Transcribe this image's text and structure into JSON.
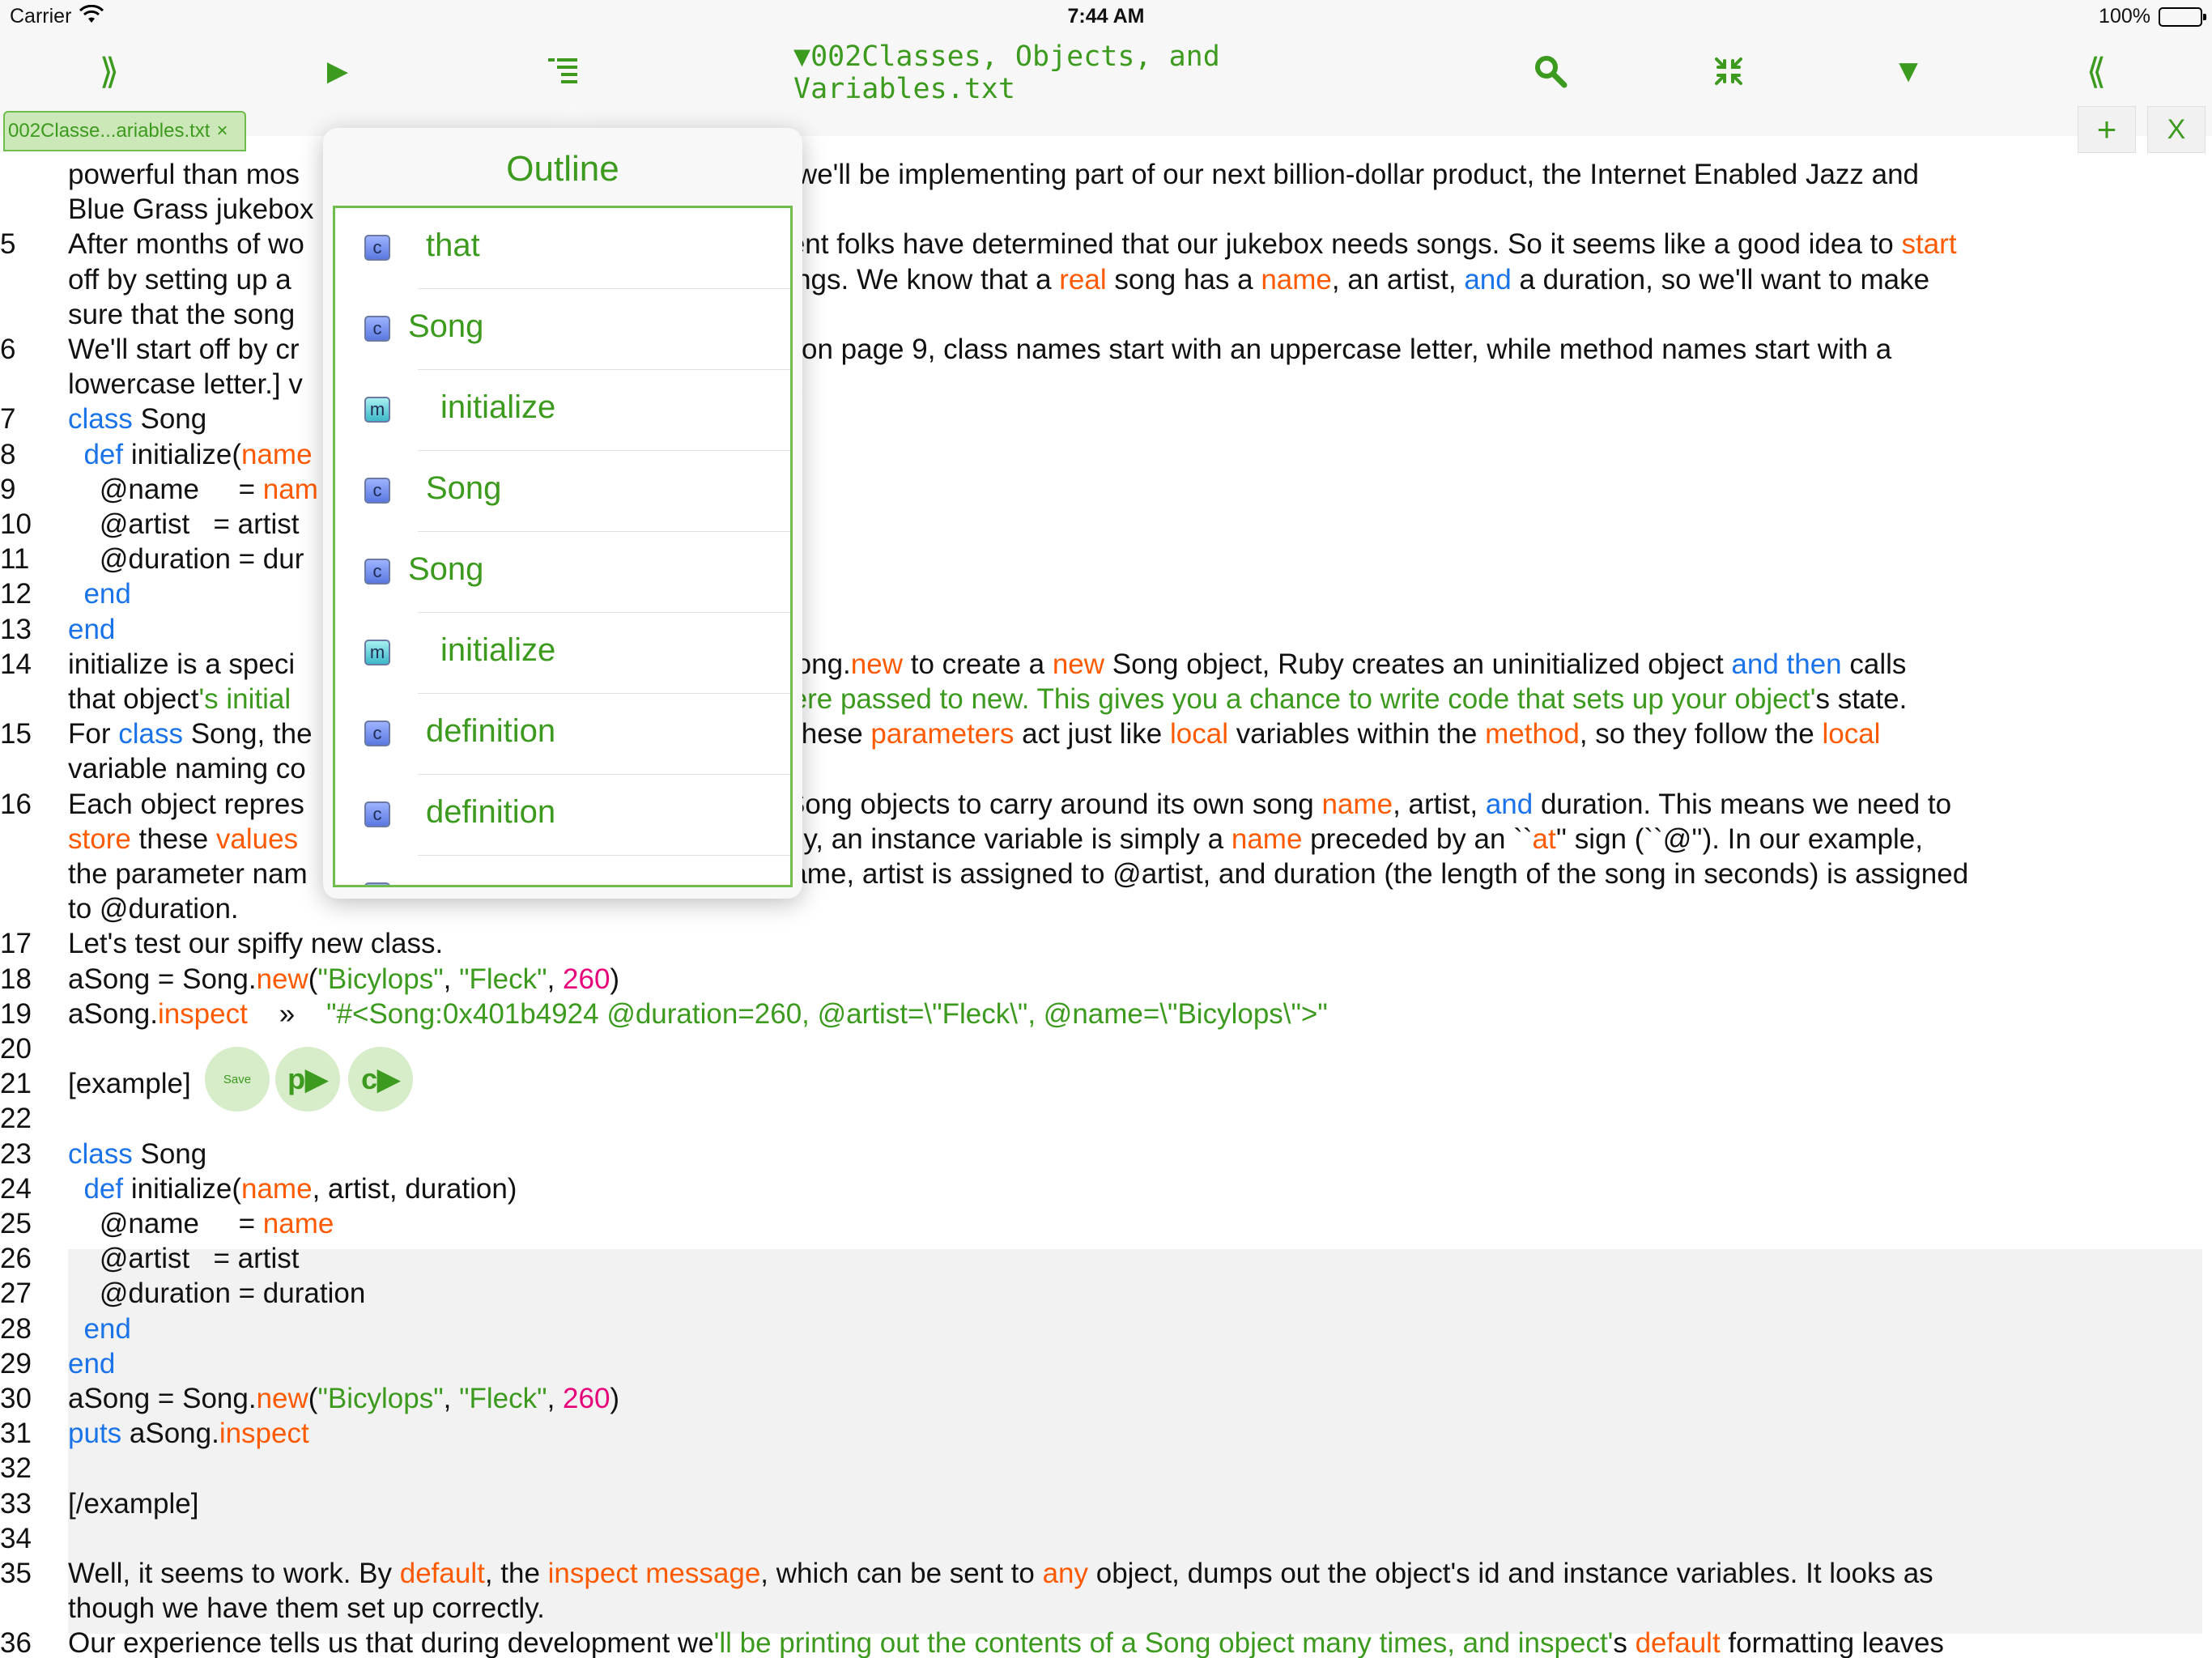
{
  "status_bar": {
    "carrier": "Carrier",
    "time": "7:44 AM",
    "battery": "100%"
  },
  "toolbar": {
    "expand_right": "⟫",
    "run": "▶",
    "outline_icon": "outline-icon",
    "title": "▼002Classes, Objects, and Variables.txt",
    "search_icon": "search-icon",
    "collapse_icon": "collapse-icon",
    "dropdown": "▼",
    "expand_left": "⟪"
  },
  "tab": {
    "label": "002Classe...ariables.txt",
    "close": "×",
    "add": "+",
    "close_all": "X"
  },
  "popover": {
    "title": "Outline",
    "items": [
      {
        "kind": "c",
        "label": "that"
      },
      {
        "kind": "c",
        "label": "Song"
      },
      {
        "kind": "m",
        "label": "initialize"
      },
      {
        "kind": "c",
        "label": "Song"
      },
      {
        "kind": "c",
        "label": "Song"
      },
      {
        "kind": "m",
        "label": "initialize"
      },
      {
        "kind": "c",
        "label": "definition"
      },
      {
        "kind": "c",
        "label": "definition"
      }
    ]
  },
  "example_buttons": {
    "save": "Save",
    "p": "p▶",
    "c": "c▶"
  },
  "editor": {
    "lines": [
      {
        "n": "",
        "t": "powerful than mos                                                 the way, we'll be implementing part of our next billion-dollar product, the Internet Enabled Jazz and"
      },
      {
        "n": "",
        "t": "Blue Grass jukebox"
      },
      {
        "n": "5",
        "html": "After months of wo                                                evelopment folks have determined that our jukebox needs songs. So it seems like a good idea to <span class='o'>start</span>"
      },
      {
        "n": "",
        "html": "off by setting up a                                                hat are songs. We know that a <span class='o'>real</span> song has a <span class='o'>name</span>, an artist, <span class='k'>and</span> a duration, so we'll want to make"
      },
      {
        "n": "",
        "t": "sure that the song"
      },
      {
        "n": "6",
        "t": "We'll start off by cr                                               nentioned on page 9, class names start with an uppercase letter, while method names start with a"
      },
      {
        "n": "",
        "t": "lowercase letter.] v                                                , initialize."
      },
      {
        "n": "7",
        "html": "<span class='k'>class</span> Song"
      },
      {
        "n": "8",
        "html": "  <span class='k'>def</span> initialize(<span class='o'>name</span>"
      },
      {
        "n": "9",
        "html": "    @name     = <span class='o'>nam</span>"
      },
      {
        "n": "10",
        "t": "    @artist   = artist"
      },
      {
        "n": "11",
        "t": "    @duration = dur"
      },
      {
        "n": "12",
        "html": "  <span class='k'>end</span>"
      },
      {
        "n": "13",
        "html": "<span class='k'>end</span>"
      },
      {
        "n": "14",
        "html": "initialize is a speci                                                you <span class='o'>call</span> Song.<span class='o'>new</span> to create a <span class='o'>new</span> Song object, Ruby creates an uninitialized object <span class='k'>and then</span> calls"
      },
      {
        "n": "",
        "html": "that object<span class='g'>'s initial                                               ters that were passed to new. This gives you a chance to write code that sets up your object'</span>s state."
      },
      {
        "n": "15",
        "html": "For <span class='k'>class</span> Song, the                                               <span class='o'>meters</span>. These <span class='o'>parameters</span> act just like <span class='o'>local</span> variables within the <span class='o'>method</span>, so they follow the <span class='o'>local</span>"
      },
      {
        "n": "",
        "t": "variable naming co                                                se letter."
      },
      {
        "n": "16",
        "html": "Each object repres                                                <span class='o'>n</span> of our Song objects to carry around its own song <span class='o'>name</span>, artist, <span class='k'>and</span> duration. This means we need to"
      },
      {
        "n": "",
        "html": "<span class='o'>store</span> these <span class='o'>values</span>                                              ject. In Ruby, an instance variable is simply a <span class='o'>name</span> preceded by an ``<span class='o'>at</span>'' sign (``@''). In our example,"
      },
      {
        "n": "",
        "t": "the parameter nam                                                  ble @name, artist is assigned to @artist, and duration (the length of the song in seconds) is assigned"
      },
      {
        "n": "",
        "t": "to @duration."
      },
      {
        "n": "17",
        "t": "Let's test our spiffy new class."
      },
      {
        "n": "18",
        "html": "aSong = Song.<span class='o'>new</span>(<span class='g'>\"Bicylops\"</span>, <span class='g'>\"Fleck\"</span>, <span class='p'>260</span>)"
      },
      {
        "n": "19",
        "html": "aSong.<span class='o'>inspect</span>    »    <span class='g'>\"#&lt;Song:0x401b4924 @duration=260, @artist=\\\"Fleck\\\", @name=\\\"Bicylops\\\"&gt;\"</span>"
      },
      {
        "n": "20",
        "t": ""
      },
      {
        "n": "21",
        "t": "[example]"
      },
      {
        "n": "22",
        "t": ""
      },
      {
        "n": "23",
        "html": "<span class='k'>class</span> Song"
      },
      {
        "n": "24",
        "html": "  <span class='k'>def</span> initialize(<span class='o'>name</span>, artist, duration)"
      },
      {
        "n": "25",
        "html": "    @name     = <span class='o'>name</span>"
      },
      {
        "n": "26",
        "t": "    @artist   = artist"
      },
      {
        "n": "27",
        "t": "    @duration = duration"
      },
      {
        "n": "28",
        "html": "  <span class='k'>end</span>"
      },
      {
        "n": "29",
        "html": "<span class='k'>end</span>"
      },
      {
        "n": "30",
        "html": "aSong = Song.<span class='o'>new</span>(<span class='g'>\"Bicylops\"</span>, <span class='g'>\"Fleck\"</span>, <span class='p'>260</span>)"
      },
      {
        "n": "31",
        "html": "<span class='k'>puts</span> aSong.<span class='o'>inspect</span>"
      },
      {
        "n": "32",
        "t": ""
      },
      {
        "n": "33",
        "t": "[/example]"
      },
      {
        "n": "34",
        "t": ""
      },
      {
        "n": "35",
        "html": "Well, it seems to work. By <span class='o'>default</span>, the <span class='o'>inspect message</span>, which can be sent to <span class='o'>any</span> object, dumps out the object's id and instance variables. It looks as"
      },
      {
        "n": "",
        "t": "though we have them set up correctly."
      },
      {
        "n": "36",
        "html": "Our experience tells us that during development we<span class='g'>'ll be printing out the contents of a Song object many times, and inspect'</span>s <span class='o'>default</span> formatting leaves"
      }
    ]
  }
}
